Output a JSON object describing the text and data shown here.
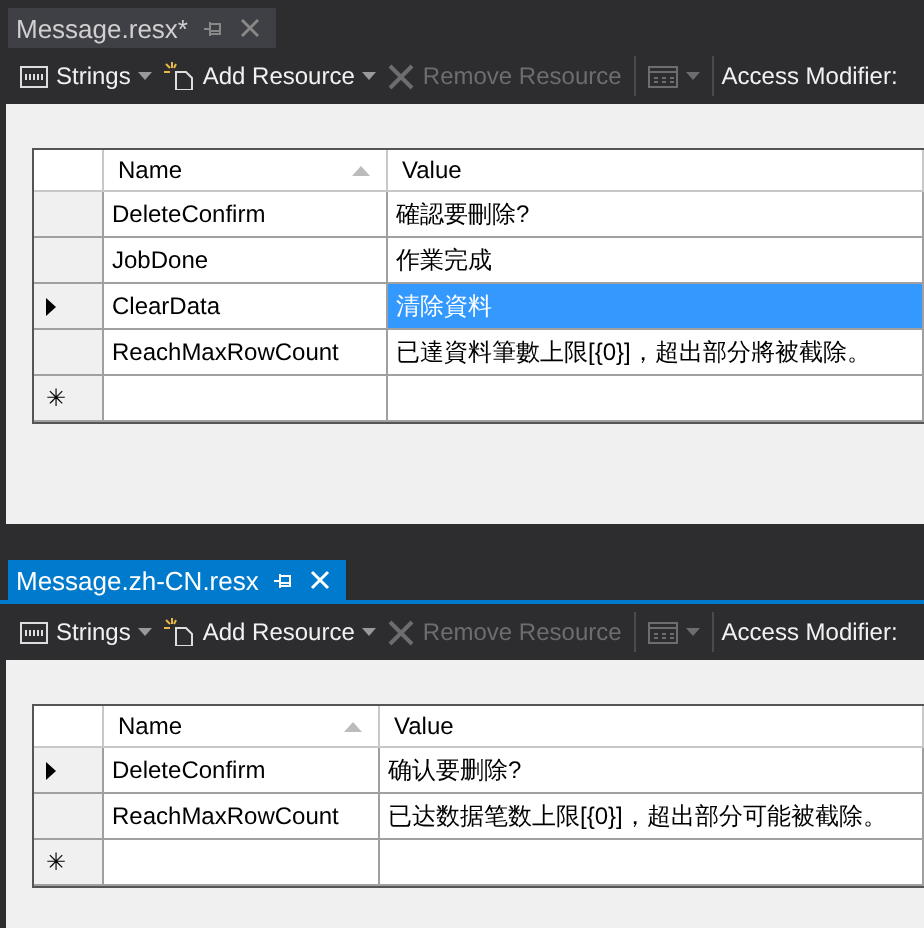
{
  "panes": [
    {
      "tab": {
        "title": "Message.resx*",
        "selected": false
      },
      "toolbar": {
        "strings": "Strings",
        "add": "Add Resource",
        "remove": "Remove Resource",
        "access": "Access Modifier:"
      },
      "columns": [
        {
          "label": "Name",
          "sorted": true
        },
        {
          "label": "Value",
          "sorted": false
        }
      ],
      "rows": [
        {
          "name": "DeleteConfirm",
          "value": "確認要刪除?",
          "current": false,
          "selected": false
        },
        {
          "name": "JobDone",
          "value": "作業完成",
          "current": false,
          "selected": false
        },
        {
          "name": "ClearData",
          "value": "清除資料",
          "current": true,
          "selected": true
        },
        {
          "name": "ReachMaxRowCount",
          "value": "已達資料筆數上限[{0}]，超出部分將被截除。",
          "current": false,
          "selected": false
        }
      ],
      "new_row_marker": "✳"
    },
    {
      "tab": {
        "title": "Message.zh-CN.resx",
        "selected": true
      },
      "toolbar": {
        "strings": "Strings",
        "add": "Add Resource",
        "remove": "Remove Resource",
        "access": "Access Modifier:"
      },
      "columns": [
        {
          "label": "Name",
          "sorted": true
        },
        {
          "label": "Value",
          "sorted": false
        }
      ],
      "rows": [
        {
          "name": "DeleteConfirm",
          "value": "确认要删除?",
          "current": true,
          "selected": false
        },
        {
          "name": "ReachMaxRowCount",
          "value": "已达数据笔数上限[{0}]，超出部分可能被截除。",
          "current": false,
          "selected": false
        }
      ],
      "new_row_marker": "✳"
    }
  ]
}
